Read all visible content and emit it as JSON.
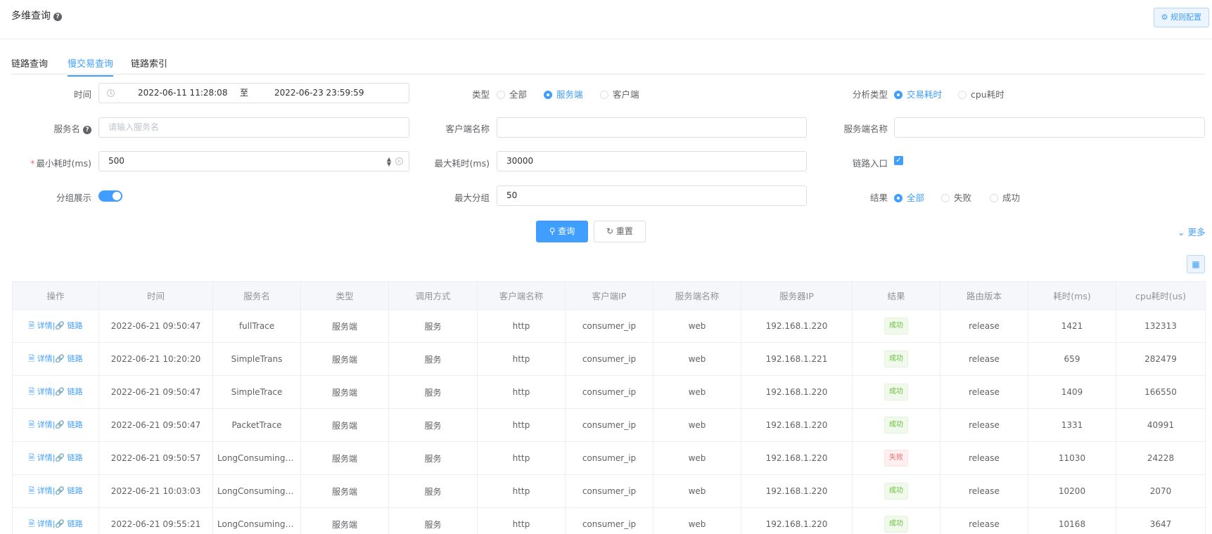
{
  "header": {
    "title": "多维查询",
    "rule_button": "⚙ 规则配置"
  },
  "tabs": [
    {
      "label": "链路查询"
    },
    {
      "label": "慢交易查询",
      "active": true
    },
    {
      "label": "链路索引"
    }
  ],
  "form": {
    "time": {
      "label": "时间",
      "start": "2022-06-11 11:28:08",
      "separator": "至",
      "end": "2022-06-23 23:59:59"
    },
    "type": {
      "label": "类型",
      "options": [
        "全部",
        "服务端",
        "客户端"
      ],
      "selected": "服务端"
    },
    "analysis_type": {
      "label": "分析类型",
      "options": [
        "交易耗时",
        "cpu耗时"
      ],
      "selected": "交易耗时"
    },
    "service_name": {
      "label": "服务名",
      "placeholder": "请输入服务名",
      "value": ""
    },
    "client_name": {
      "label": "客户端名称",
      "value": ""
    },
    "server_name": {
      "label": "服务端名称",
      "value": ""
    },
    "min_cost": {
      "label": "最小耗时(ms)",
      "required_mark": "*",
      "value": "500"
    },
    "max_cost": {
      "label": "最大耗时(ms)",
      "value": "30000"
    },
    "chain_entry": {
      "label": "链路入口",
      "checked": true
    },
    "group_display": {
      "label": "分组展示",
      "on": true
    },
    "max_group": {
      "label": "最大分组",
      "value": "50"
    },
    "result": {
      "label": "结果",
      "options": [
        "全部",
        "失败",
        "成功"
      ],
      "selected": "全部"
    },
    "query_button": "查询",
    "reset_button": "重置",
    "more_link": "更多"
  },
  "table": {
    "columns": [
      "操作",
      "时间",
      "服务名",
      "类型",
      "调用方式",
      "客户端名称",
      "客户端IP",
      "服务端名称",
      "服务器IP",
      "结果",
      "路由版本",
      "耗时(ms)",
      "cpu耗时(us)"
    ],
    "action_detail": "详情",
    "action_chain": "链路",
    "rows": [
      {
        "time": "2022-06-21 09:50:47",
        "service": "fullTrace",
        "type": "服务端",
        "call": "服务",
        "client": "http",
        "client_ip": "consumer_ip",
        "server": "web",
        "server_ip": "192.168.1.220",
        "result": "成功",
        "route": "release",
        "cost": "1421",
        "cpu": "132313"
      },
      {
        "time": "2022-06-21 10:20:20",
        "service": "SimpleTrans",
        "type": "服务端",
        "call": "服务",
        "client": "http",
        "client_ip": "consumer_ip",
        "server": "web",
        "server_ip": "192.168.1.221",
        "result": "成功",
        "route": "release",
        "cost": "659",
        "cpu": "282479"
      },
      {
        "time": "2022-06-21 09:50:47",
        "service": "SimpleTrace",
        "type": "服务端",
        "call": "服务",
        "client": "http",
        "client_ip": "consumer_ip",
        "server": "web",
        "server_ip": "192.168.1.220",
        "result": "成功",
        "route": "release",
        "cost": "1409",
        "cpu": "166550"
      },
      {
        "time": "2022-06-21 09:50:47",
        "service": "PacketTrace",
        "type": "服务端",
        "call": "服务",
        "client": "http",
        "client_ip": "consumer_ip",
        "server": "web",
        "server_ip": "192.168.1.220",
        "result": "成功",
        "route": "release",
        "cost": "1331",
        "cpu": "40991"
      },
      {
        "time": "2022-06-21 09:50:57",
        "service": "LongConsumingTr...",
        "type": "服务端",
        "call": "服务",
        "client": "http",
        "client_ip": "consumer_ip",
        "server": "web",
        "server_ip": "192.168.1.220",
        "result": "失败",
        "route": "release",
        "cost": "11030",
        "cpu": "24228"
      },
      {
        "time": "2022-06-21 10:03:03",
        "service": "LongConsumingTr...",
        "type": "服务端",
        "call": "服务",
        "client": "http",
        "client_ip": "consumer_ip",
        "server": "web",
        "server_ip": "192.168.1.220",
        "result": "成功",
        "route": "release",
        "cost": "10200",
        "cpu": "2070"
      },
      {
        "time": "2022-06-21 09:55:21",
        "service": "LongConsumingTr...",
        "type": "服务端",
        "call": "服务",
        "client": "http",
        "client_ip": "consumer_ip",
        "server": "web",
        "server_ip": "192.168.1.220",
        "result": "成功",
        "route": "release",
        "cost": "10168",
        "cpu": "3647"
      }
    ]
  }
}
